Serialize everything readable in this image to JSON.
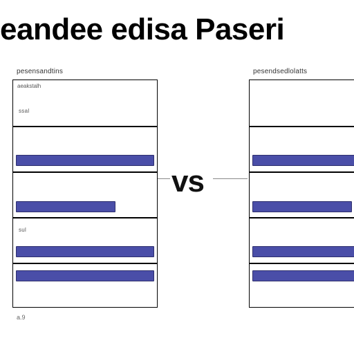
{
  "title": "eandee edisa Paseri",
  "vs_label": "vs",
  "left": {
    "header": "pesensandtins",
    "row1": "ssal",
    "row2": "",
    "row3": "sul",
    "row4": "",
    "tiny1": "aeakstalh"
  },
  "right": {
    "header": "pesendsedlolatts",
    "row1": "",
    "row2": "",
    "row3": "",
    "row4": ""
  },
  "footnote": "a.9"
}
